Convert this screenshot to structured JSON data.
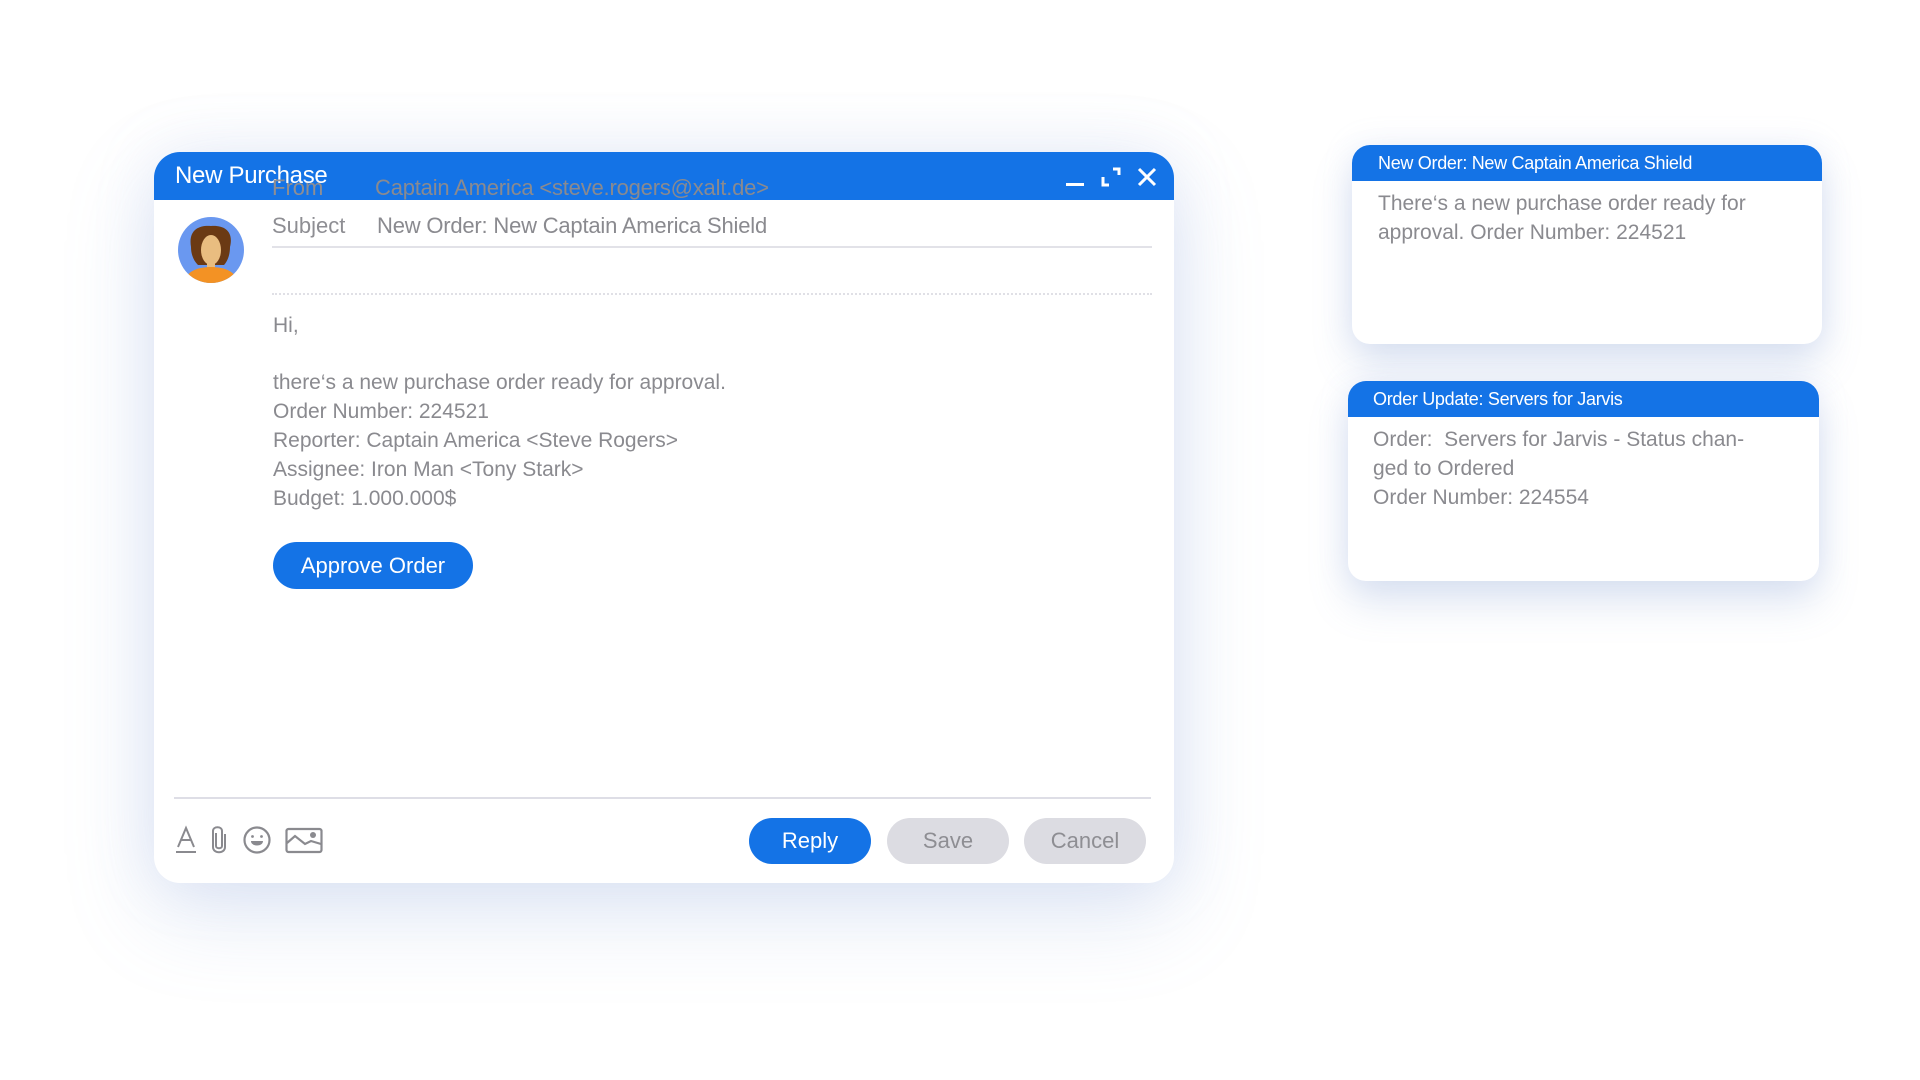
{
  "mail_window": {
    "title": "New Purchase",
    "controls": [
      "minimize-icon",
      "maximize-icon",
      "close-icon"
    ],
    "from_label": "From",
    "from_value": "Captain America <steve.rogers@xalt.de>",
    "subject_label": "Subject",
    "subject_value": "New Order: New Captain America Shield",
    "body": {
      "greeting": "Hi,",
      "lines": [
        "there‘s a new purchase order ready for approval.",
        "Order Number: 224521",
        "Reporter: Captain America <Steve Rogers>",
        "Assignee: Iron Man <Tony Stark>",
        "Budget: 1.000.000$"
      ]
    },
    "approve_label": "Approve Order",
    "toolbar_icons": [
      "text-format-icon",
      "attachment-icon",
      "emoji-icon",
      "image-icon"
    ],
    "reply_label": "Reply",
    "save_label": "Save",
    "cancel_label": "Cancel"
  },
  "notifications": [
    {
      "title": "New Order: New Captain America Shield",
      "lines": [
        "There‘s a new purchase order ready for",
        "approval. Order Number: 224521"
      ]
    },
    {
      "title": "Order Update: Servers for Jarvis",
      "lines": [
        "Order:  Servers for Jarvis - Status chan-",
        "ged to Ordered",
        "Order Number: 224554"
      ]
    }
  ],
  "colors": {
    "accent": "#1473e6",
    "text_gray": "#8a8a8f",
    "button_secondary": "#dcdce2"
  }
}
